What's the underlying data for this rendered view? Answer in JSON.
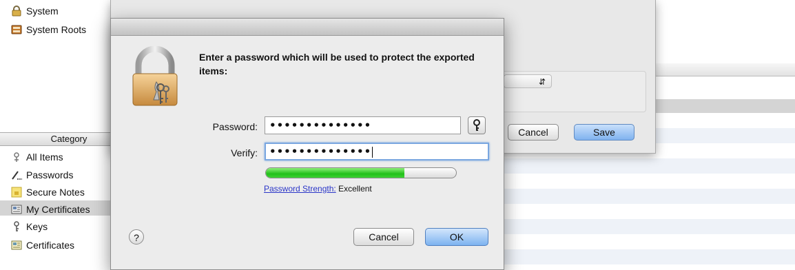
{
  "sidebar": {
    "keychains": [
      {
        "label": "System",
        "icon": "lock-icon"
      },
      {
        "label": "System Roots",
        "icon": "cabinet-icon"
      }
    ],
    "category_header": "Category",
    "categories": [
      {
        "label": "All Items",
        "icon": "all-items-icon"
      },
      {
        "label": "Passwords",
        "icon": "password-icon"
      },
      {
        "label": "Secure Notes",
        "icon": "note-icon"
      },
      {
        "label": "My Certificates",
        "icon": "my-certificates-icon",
        "selected": true
      },
      {
        "label": "Keys",
        "icon": "key-icon"
      },
      {
        "label": "Certificates",
        "icon": "certificate-icon"
      }
    ]
  },
  "save_sheet": {
    "cancel_label": "Cancel",
    "save_label": "Save"
  },
  "dialog": {
    "prompt": "Enter a password which will be used to protect the exported items:",
    "password_label": "Password:",
    "password_value": "••••••••••••••",
    "verify_label": "Verify:",
    "verify_value": "••••••••••••••",
    "strength_link": "Password Strength:",
    "strength_value": "Excellent",
    "strength_fraction": 0.73,
    "help_label": "?",
    "cancel_label": "Cancel",
    "ok_label": "OK"
  },
  "colors": {
    "accent": "#7aa7e0",
    "strength_green": "#22c01a",
    "link": "#2a35c8"
  }
}
